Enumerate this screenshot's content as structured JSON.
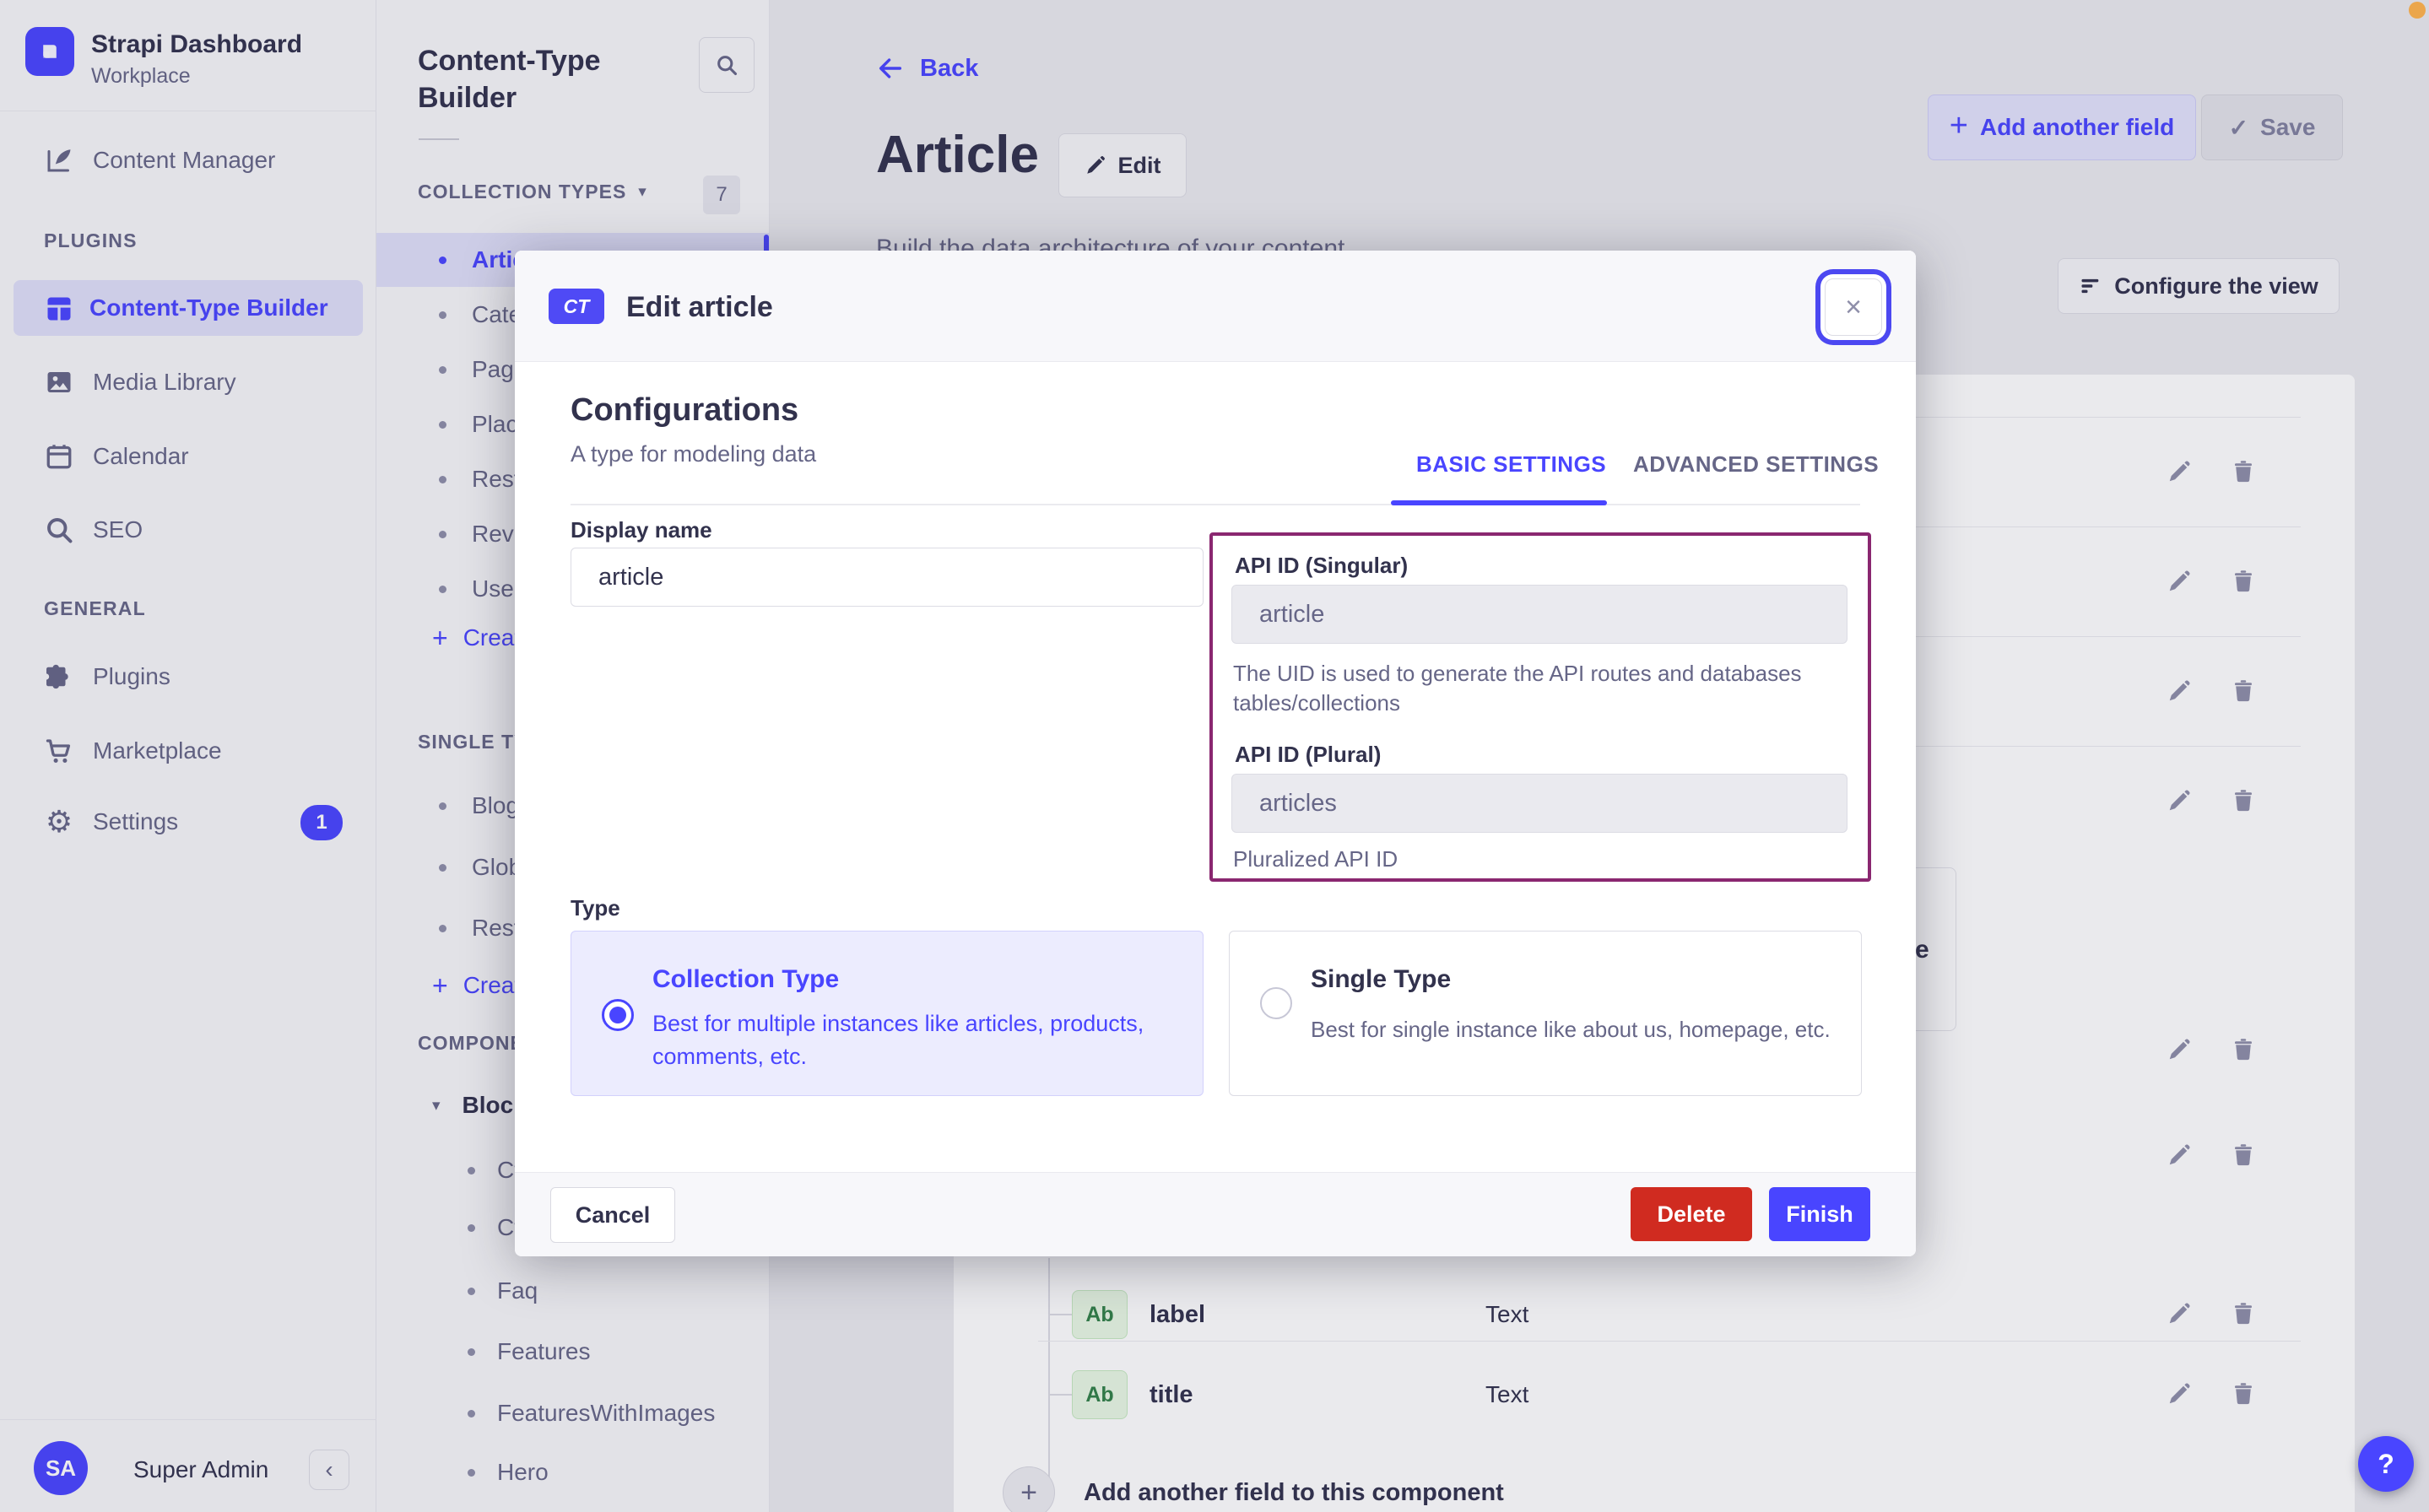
{
  "icons": {
    "close": "×",
    "check": "✓",
    "plus": "+",
    "collapse": "‹",
    "caret_down": "▾",
    "question": "?",
    "gear": "⚙"
  },
  "sidebar": {
    "brand_title": "Strapi Dashboard",
    "brand_subtitle": "Workplace",
    "content_manager": "Content Manager",
    "plugins_heading": "PLUGINS",
    "plugin_items": [
      {
        "label": "Content-Type Builder"
      },
      {
        "label": "Media Library"
      },
      {
        "label": "Calendar"
      },
      {
        "label": "SEO"
      }
    ],
    "general_heading": "GENERAL",
    "general_items": [
      {
        "label": "Plugins"
      },
      {
        "label": "Marketplace"
      },
      {
        "label": "Settings",
        "badge": "1"
      }
    ],
    "user_initials": "SA",
    "user_name": "Super Admin"
  },
  "subnav": {
    "title": "Content-Type Builder",
    "collection_heading": "COLLECTION TYPES",
    "collection_count": "7",
    "collection_items": [
      "Artic",
      "Cate",
      "Page",
      "Plac",
      "Rest",
      "Revi",
      "User"
    ],
    "create_link": "Create",
    "single_heading": "SINGLE TY",
    "single_items": [
      "Blog",
      "Glob",
      "Rest"
    ],
    "components_heading": "COMPONE",
    "component_group": "Bloc",
    "component_items": [
      "Ct",
      "Ct",
      "Faq",
      "Features",
      "FeaturesWithImages",
      "Hero"
    ]
  },
  "page": {
    "back": "Back",
    "title": "Article",
    "edit": "Edit",
    "subtitle": "Build the data architecture of your content",
    "add_field": "Add another field",
    "save": "Save",
    "configure": "Configure the view",
    "fields": [
      {
        "badge": "Ab",
        "name": "label",
        "type": "Text"
      },
      {
        "badge": "Ab",
        "name": "title",
        "type": "Text"
      }
    ],
    "add_component_field": "Add another field to this component",
    "partial_text": "e"
  },
  "modal": {
    "badge": "CT",
    "title": "Edit article",
    "heading": "Configurations",
    "subheading": "A type for modeling data",
    "tab_basic": "BASIC SETTINGS",
    "tab_advanced": "ADVANCED SETTINGS",
    "display_name_label": "Display name",
    "display_name_value": "article",
    "api_singular_label": "API ID (Singular)",
    "api_singular_value": "article",
    "api_singular_hint": "The UID is used to generate the API routes and databases tables/collections",
    "api_plural_label": "API ID (Plural)",
    "api_plural_value": "articles",
    "api_plural_hint": "Pluralized API ID",
    "type_label": "Type",
    "collection_type_title": "Collection Type",
    "collection_type_desc": "Best for multiple instances like articles, products, comments, etc.",
    "single_type_title": "Single Type",
    "single_type_desc": "Best for single instance like about us, homepage, etc.",
    "cancel": "Cancel",
    "delete": "Delete",
    "finish": "Finish"
  },
  "colors": {
    "primary": "#4945ff",
    "danger": "#d02b20",
    "highlight_border": "#8a2770",
    "success_text": "#328048",
    "accent_dot": "#eba64c"
  }
}
